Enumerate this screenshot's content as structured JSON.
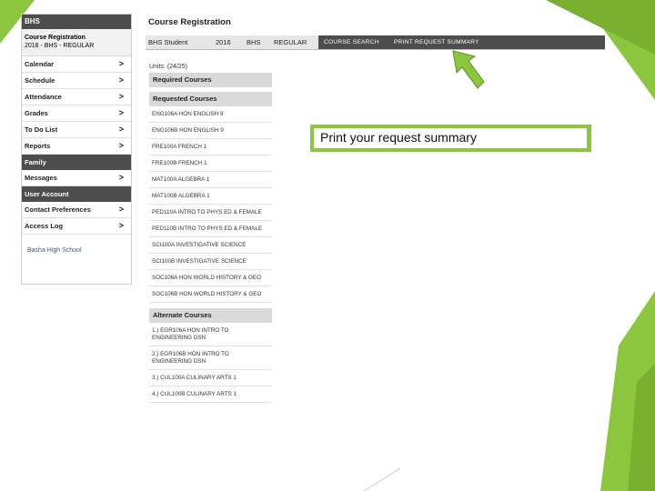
{
  "sidebar": {
    "header": "BHS",
    "registration_title": "Course Registration",
    "registration_sub": "2016 - BHS - REGULAR",
    "items_main": [
      {
        "label": "Calendar"
      },
      {
        "label": "Schedule"
      },
      {
        "label": "Attendance"
      },
      {
        "label": "Grades"
      },
      {
        "label": "To Do List"
      },
      {
        "label": "Reports"
      }
    ],
    "section_family": "Family",
    "items_family": [
      {
        "label": "Messages"
      }
    ],
    "section_user": "User Account",
    "items_user": [
      {
        "label": "Contact Preferences"
      },
      {
        "label": "Access Log"
      }
    ],
    "school": "Basha High School"
  },
  "main": {
    "title": "Course Registration",
    "topbar": {
      "student": "BHS Student",
      "year": "2016",
      "school": "BHS",
      "type": "REGULAR",
      "tab_search": "COURSE SEARCH",
      "tab_print": "PRINT REQUEST SUMMARY"
    },
    "units": "Units: (24/25)",
    "required_header": "Required Courses",
    "requested_header": "Requested Courses",
    "requested": [
      "ENG106A HON ENGLISH 9",
      "ENG106B HON ENGLISH 9",
      "FRE100A FRENCH 1",
      "FRE100B FRENCH 1",
      "MAT100A ALGEBRA 1",
      "MAT100B ALGEBRA 1",
      "PED110A INTRO TO PHYS ED & FEMALE",
      "PED110B INTRO TO PHYS ED & FEMALE",
      "SCI100A INVESTIGATIVE SCIENCE",
      "SCI100B INVESTIGATIVE SCIENCE",
      "SOC106A HON WORLD HISTORY & GEO",
      "SOC106B HON WORLD HISTORY & GEO"
    ],
    "alternate_header": "Alternate Courses",
    "alternates": [
      "1.) EGR106A HON INTRO TO ENGINEERING DSN",
      "2.) EGR106B HON INTRO TO ENGINEERING DSN",
      "3.) CUL100A CULINARY ARTS 1",
      "4.) CUL100B CULINARY ARTS 1"
    ]
  },
  "callout": "Print your request summary",
  "colors": {
    "accent_green": "#8cc63f",
    "dark_bar": "#4d4d4d"
  }
}
